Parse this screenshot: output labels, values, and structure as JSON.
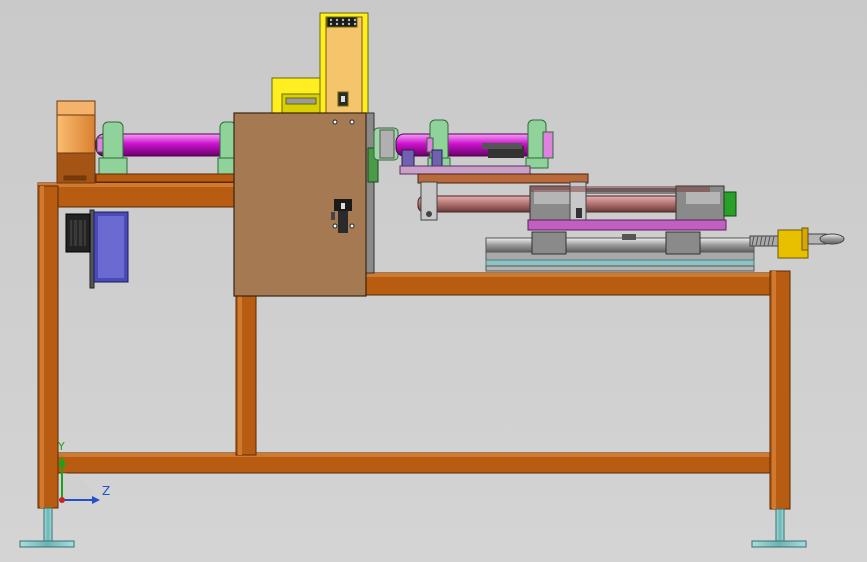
{
  "viewport": {
    "background": "#cecece",
    "triad": {
      "y_label": "Y",
      "z_label": "Z",
      "y_color": "#1aa31a",
      "z_color": "#2050d0"
    }
  },
  "palette": {
    "frame": "#b85c12",
    "frame_edge": "#5a2a05",
    "panel": "#a57a52",
    "shaft": "#cc11cc",
    "bearing": "#8fd39a",
    "motor_housing": "#f0a050",
    "motor_blue": "#4a4ab8",
    "yellow_guard": "#ffee20",
    "slide_grey": "#b5b5b5",
    "plate_purple": "#c060c0",
    "knob_yellow": "#e8c000",
    "foot_cyan": "#7ec8c8"
  }
}
